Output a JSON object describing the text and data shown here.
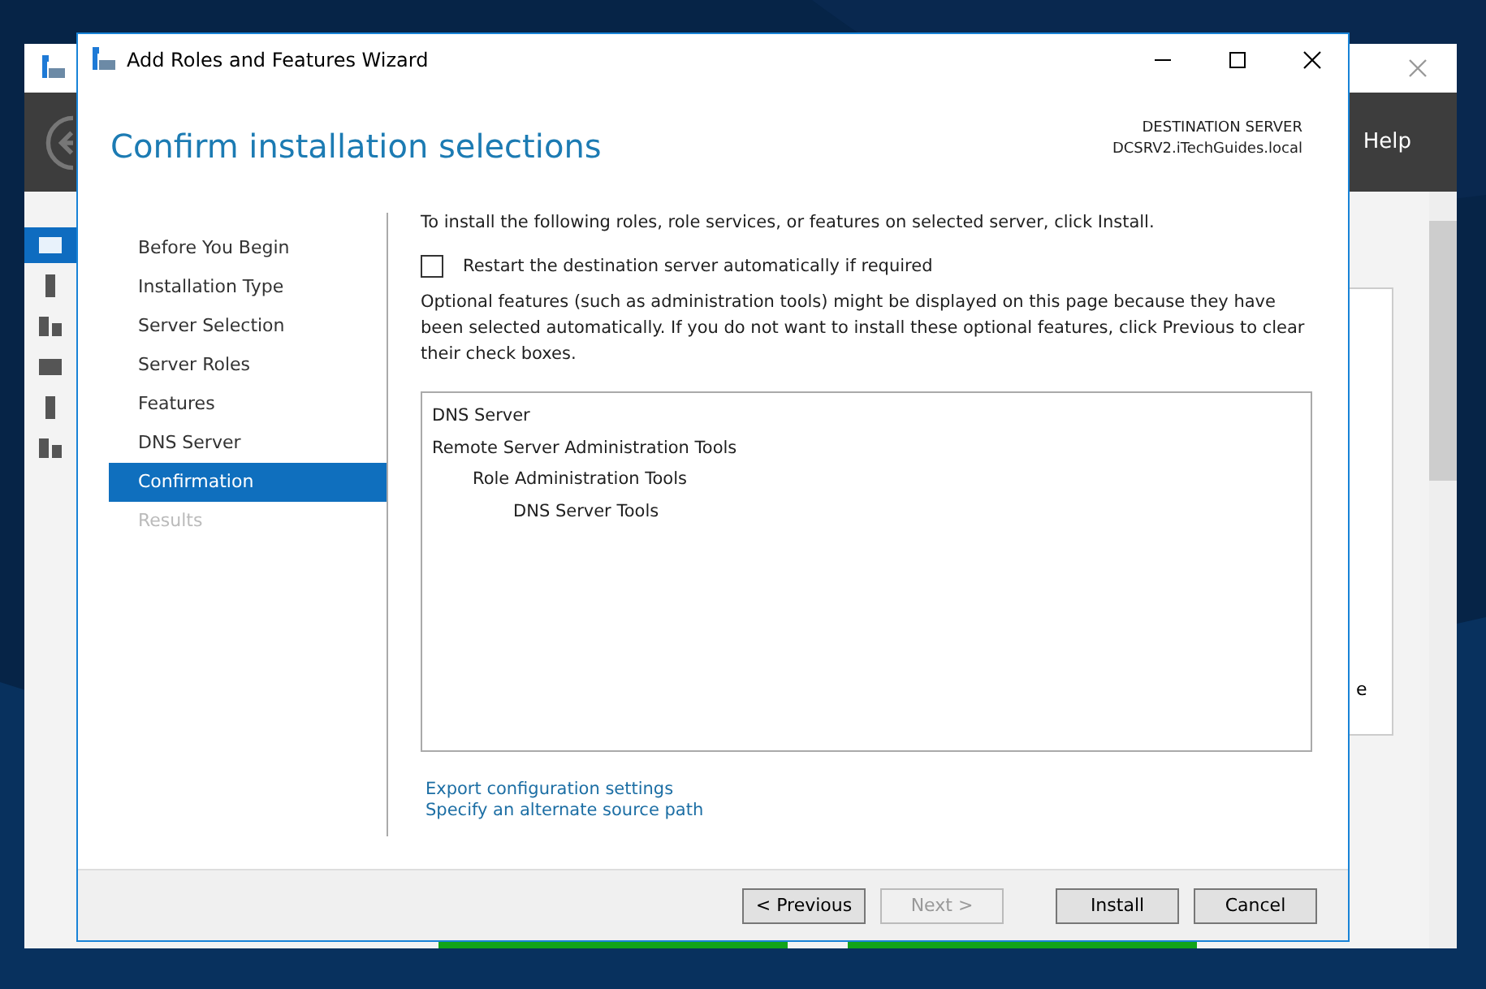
{
  "background_window": {
    "header": {
      "help": "Help"
    },
    "sidebar": {
      "items": [
        {
          "selected": true
        },
        {
          "selected": false
        },
        {
          "selected": false
        },
        {
          "selected": false
        },
        {
          "selected": false
        },
        {
          "selected": false
        }
      ]
    },
    "panel_text": "e"
  },
  "wizard": {
    "title": "Add Roles and Features Wizard",
    "heading": "Confirm installation selections",
    "destination": {
      "label": "DESTINATION SERVER",
      "server": "DCSRV2.iTechGuides.local"
    },
    "steps": [
      {
        "label": "Before You Begin",
        "selected": false,
        "disabled": false
      },
      {
        "label": "Installation Type",
        "selected": false,
        "disabled": false
      },
      {
        "label": "Server Selection",
        "selected": false,
        "disabled": false
      },
      {
        "label": "Server Roles",
        "selected": false,
        "disabled": false
      },
      {
        "label": "Features",
        "selected": false,
        "disabled": false
      },
      {
        "label": "DNS Server",
        "selected": false,
        "disabled": false
      },
      {
        "label": "Confirmation",
        "selected": true,
        "disabled": false
      },
      {
        "label": "Results",
        "selected": false,
        "disabled": true
      }
    ],
    "intro": "To install the following roles, role services, or features on selected server, click Install.",
    "restart": {
      "label": "Restart the destination server automatically if required",
      "checked": false
    },
    "note": "Optional features (such as administration tools) might be displayed on this page because they have been selected automatically. If you do not want to install these optional features, click Previous to clear their check boxes.",
    "selections": [
      {
        "label": "DNS Server"
      },
      {
        "label": "Remote Server Administration Tools",
        "children": [
          {
            "label": "Role Administration Tools",
            "children": [
              {
                "label": "DNS Server Tools"
              }
            ]
          }
        ]
      }
    ],
    "links": [
      "Export configuration settings",
      "Specify an alternate source path"
    ],
    "buttons": [
      {
        "label": "< Previous",
        "disabled": false
      },
      {
        "label": "Next >",
        "disabled": true
      },
      {
        "label": "Install",
        "disabled": false
      },
      {
        "label": "Cancel",
        "disabled": false
      }
    ]
  }
}
